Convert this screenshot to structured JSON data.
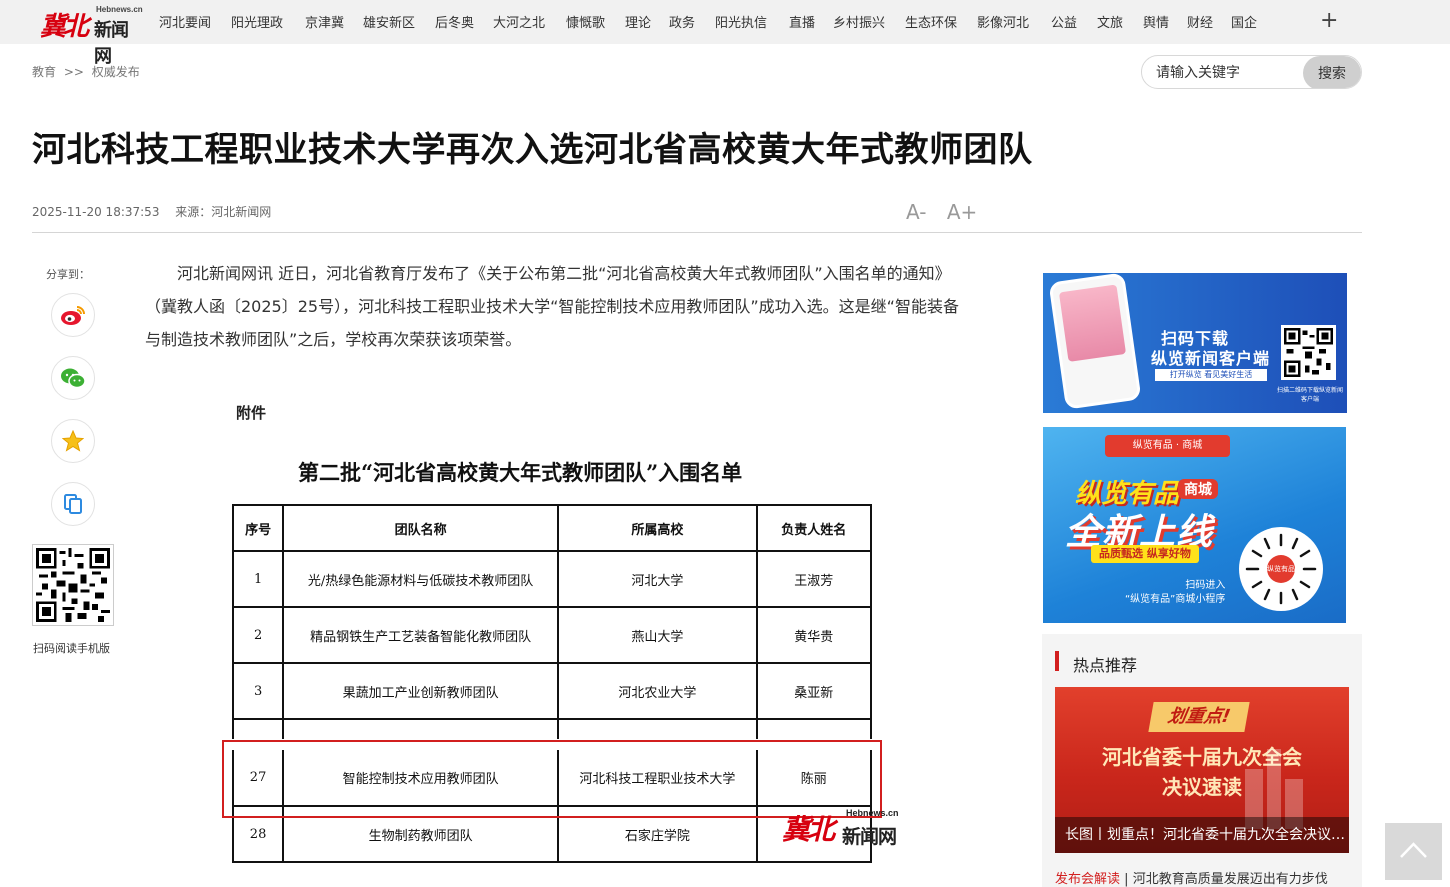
{
  "logo": {
    "brand": "冀北",
    "site": "新闻网",
    "domain": "Hebnews.cn"
  },
  "nav": {
    "items": [
      "河北要闻",
      "阳光理政",
      "京津冀",
      "雄安新区",
      "后冬奥",
      "大河之北",
      "慷慨歌",
      "理论",
      "政务",
      "阳光执信",
      "直播",
      "乡村振兴",
      "生态环保",
      "影像河北",
      "公益",
      "文旅",
      "舆情",
      "财经",
      "国企"
    ],
    "more": "+"
  },
  "breadcrumb": {
    "section": "教育",
    "sep": ">>",
    "sub": "权威发布"
  },
  "search": {
    "placeholder": "请输入关键字",
    "button": "搜索"
  },
  "article": {
    "title": "河北科技工程职业技术大学再次入选河北省高校黄大年式教师团队",
    "date": "2025-11-20 18:37:53",
    "source_label": "来源：",
    "source": "河北新闻网",
    "font_down": "A-",
    "font_up": "A+",
    "paragraph": "河北新闻网讯 近日，河北省教育厅发布了《关于公布第二批“河北省高校黄大年式教师团队”入围名单的通知》（冀教人函〔2025〕25号），河北科技工程职业技术大学“智能控制技术应用教师团队”成功入选。这是继“智能装备与制造技术教师团队”之后，学校再次荣获该项荣誉。"
  },
  "share": {
    "label": "分享到：",
    "buttons": [
      "weibo-icon",
      "wechat-icon",
      "qzone-icon",
      "copy-link-icon"
    ],
    "qr_caption": "扫码阅读手机版"
  },
  "document": {
    "attachment": "附件",
    "title": "第二批“河北省高校黄大年式教师团队”入围名单",
    "headers": [
      "序号",
      "团队名称",
      "所属高校",
      "负责人姓名"
    ],
    "rows": [
      [
        "1",
        "光/热绿色能源材料与低碳技术教师团队",
        "河北大学",
        "王淑芳"
      ],
      [
        "2",
        "精品钢铁生产工艺装备智能化教师团队",
        "燕山大学",
        "黄华贵"
      ],
      [
        "3",
        "果蔬加工产业创新教师团队",
        "河北农业大学",
        "桑亚新"
      ]
    ],
    "highlight_row": [
      "27",
      "智能控制技术应用教师团队",
      "河北科技工程职业技术大学",
      "陈丽"
    ],
    "last_row": [
      "28",
      "生物制药教师团队",
      "石家庄学院",
      ""
    ]
  },
  "ads": {
    "app": {
      "line1": "扫码下载",
      "line2": "纵览新闻客户端",
      "line3": "打开纵览 看见美好生活",
      "qr_caption": "扫描二维码下载纵览新闻客户端"
    },
    "mall": {
      "head": "纵览有品 · 商城",
      "line1": "纵览有品",
      "line1_tag": "商城",
      "line2": "全新上线",
      "line3": "品质甄选 纵享好物",
      "caption1": "扫码进入",
      "caption2": "“纵览有品”商城小程序",
      "qr_center": "纵览有品"
    }
  },
  "hot": {
    "heading": "热点推荐",
    "pic_tag": "划重点!",
    "pic_line1": "河北省委十届九次全会",
    "pic_line2": "决议速读",
    "pic_caption": "长图丨划重点！河北省委十届九次全会决议速读",
    "item_tag": "发布会解读",
    "item_sep": "|",
    "item_text": "河北教育高质量发展迈出有力步伐"
  },
  "colors": {
    "brand_red": "#d7000f",
    "accent_red": "#d21f1f",
    "nav_bg": "#f1f1f1"
  }
}
